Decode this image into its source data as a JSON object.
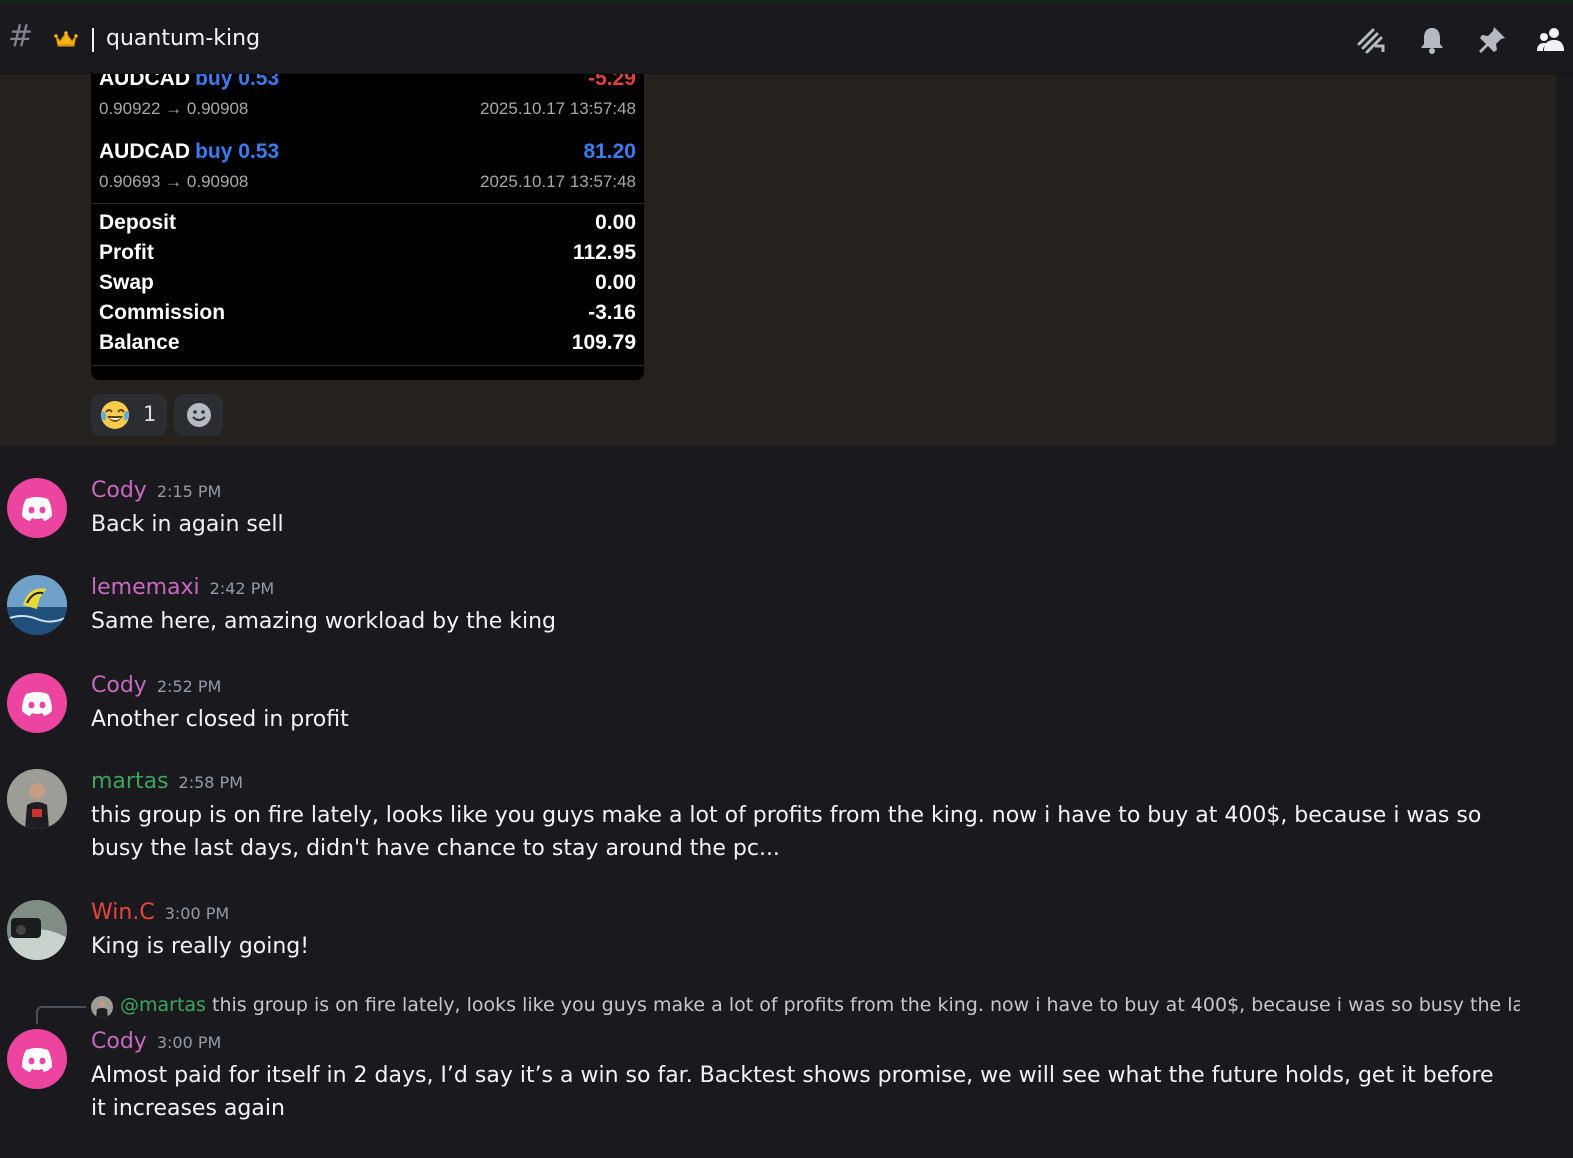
{
  "header": {
    "channel_icon": "hash-icon",
    "channel_emoji": "crown-emoji",
    "channel_name": "quantum-king",
    "icons": [
      "threads-icon",
      "bell-icon",
      "pin-icon",
      "members-icon"
    ]
  },
  "trade_card": {
    "trades": [
      {
        "symbol": "AUDCAD",
        "side": "buy 0.53",
        "pnl": "-5.29",
        "prices": "0.90922 → 0.90908",
        "time": "2025.10.17 13:57:48"
      },
      {
        "symbol": "AUDCAD",
        "side": "buy 0.53",
        "pnl": "81.20",
        "prices": "0.90693 → 0.90908",
        "time": "2025.10.17 13:57:48"
      }
    ],
    "summary": [
      {
        "label": "Deposit",
        "value": "0.00"
      },
      {
        "label": "Profit",
        "value": "112.95"
      },
      {
        "label": "Swap",
        "value": "0.00"
      },
      {
        "label": "Commission",
        "value": "-3.16"
      },
      {
        "label": "Balance",
        "value": "109.79"
      }
    ]
  },
  "reactions": [
    {
      "emoji": "joy-emoji",
      "count": "1"
    },
    {
      "emoji": "add-reaction-icon",
      "count": ""
    }
  ],
  "colors": {
    "cody": "#c869c0",
    "lememaxi": "#c869c0",
    "martas": "#3ba55d",
    "winc": "#e8453c",
    "discord_pink": "#eb459f"
  },
  "messages": [
    {
      "author": "Cody",
      "time": "2:15 PM",
      "text": "Back in again sell"
    },
    {
      "author": "lememaxi",
      "time": "2:42 PM",
      "text": "Same here, amazing workload by the king"
    },
    {
      "author": "Cody",
      "time": "2:52 PM",
      "text": "Another closed in profit"
    },
    {
      "author": "martas",
      "time": "2:58 PM",
      "text": "this group is on fire lately, looks like you guys make a lot of profits from the king. now i have to buy at 400$, because i was so busy the last days, didn't have chance to stay around the pc..."
    },
    {
      "author": "Win.C",
      "time": "3:00 PM",
      "text": "King is really going!"
    },
    {
      "author": "Cody",
      "time": "3:00 PM",
      "text": "Almost paid for itself in 2 days, I’d say it’s a win so far. Backtest shows promise, we will see what the future holds, get it before it increases again"
    }
  ],
  "reply": {
    "mention": "@martas",
    "text": "this group is on fire lately, looks like you guys make a lot of profits from the king. now i have to buy at 400$, because i was so busy the last days, di..."
  }
}
